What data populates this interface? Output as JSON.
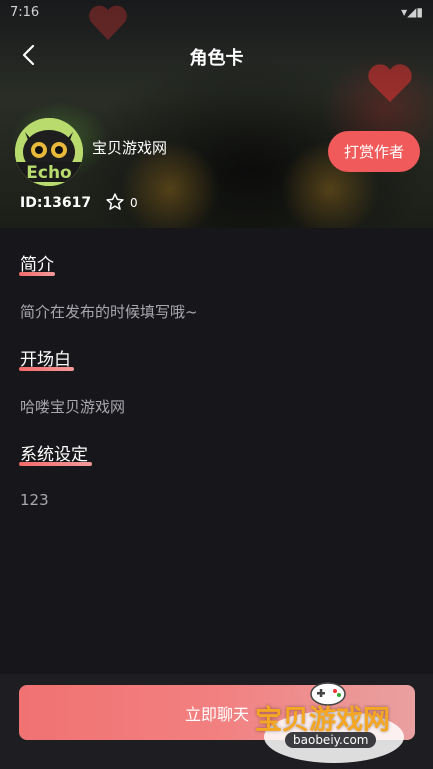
{
  "status_bar": {
    "time": "7:16",
    "right": "▾◢▮"
  },
  "header": {
    "title": "角色卡"
  },
  "author": {
    "name": "宝贝游戏网",
    "id": "ID:13617",
    "star_count": "0",
    "tip_label": "打赏作者"
  },
  "sections": [
    {
      "title": "简介",
      "text": "简介在发布的时候填写哦~"
    },
    {
      "title": "开场白",
      "text": "哈喽宝贝游戏网"
    },
    {
      "title": "系统设定",
      "text": "123"
    }
  ],
  "footer": {
    "chat_label": "立即聊天"
  },
  "watermark": {
    "text": "宝贝游戏网",
    "url": "baobeiy.com"
  },
  "colors": {
    "accent": "#f15a5a",
    "background": "#17171b"
  }
}
